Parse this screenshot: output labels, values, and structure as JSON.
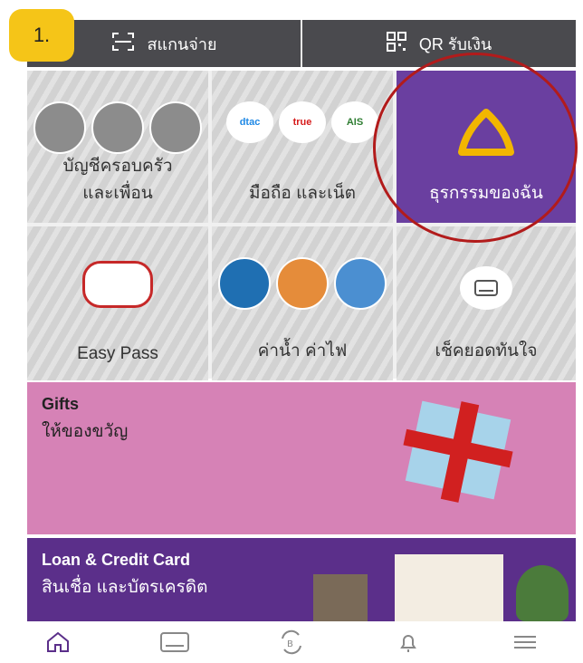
{
  "badge": "1.",
  "top": {
    "scan": "สแกนจ่าย",
    "qr": "QR รับเงิน"
  },
  "tiles": [
    {
      "label": "บัญชีครอบครัว\nและเพื่อน"
    },
    {
      "label": "มือถือ และเน็ต",
      "brands": [
        "dtac",
        "true",
        "AIS"
      ]
    },
    {
      "label": "ธุรกรรมของฉัน"
    },
    {
      "label": "Easy Pass"
    },
    {
      "label": "ค่าน้ำ ค่าไฟ"
    },
    {
      "label": "เช็คยอดทันใจ"
    }
  ],
  "banners": {
    "gifts": {
      "title": "Gifts",
      "subtitle": "ให้ของขวัญ"
    },
    "loan": {
      "title": "Loan & Credit Card",
      "subtitle": "สินเชื่อ และบัตรเครดิต"
    }
  }
}
